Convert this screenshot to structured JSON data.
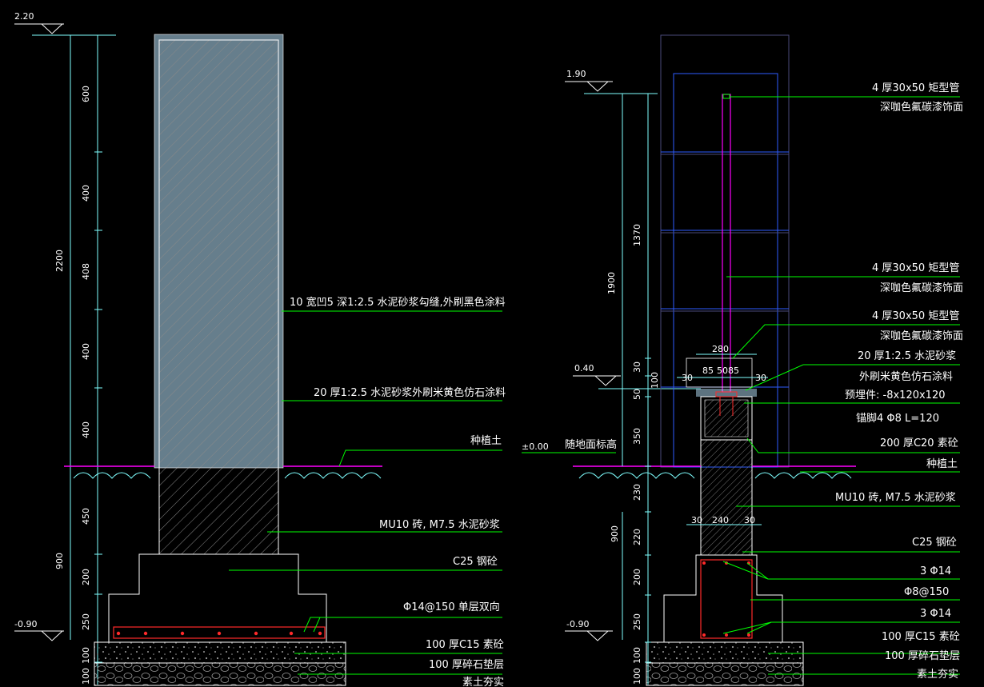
{
  "left": {
    "elev_top": "2.20",
    "elev_bottom": "-0.90",
    "dims_vertical": [
      "600",
      "400",
      "408",
      "400",
      "400",
      "2200",
      "450",
      "200",
      "250",
      "900",
      "100",
      "100"
    ],
    "labels": [
      "10  宽凹5 深1:2.5  水泥砂浆勾缝,外刷黑色涂料",
      "20  厚1:2.5  水泥砂浆外刷米黄色仿石涂料",
      "种植土",
      "MU10  砖, M7.5  水泥砂浆",
      "C25  钢砼",
      "Φ14@150  单层双向",
      "100  厚C15  素砼",
      "100  厚碎石垫层",
      "素土夯实"
    ]
  },
  "right": {
    "elev_top": "1.90",
    "elev_mid": "0.40",
    "elev_zero": "±0.00",
    "elev_bottom": "-0.90",
    "ground_label": "随地面标高",
    "dims_vertical": [
      "1370",
      "1900",
      "30",
      "100",
      "50",
      "350",
      "230",
      "220",
      "200",
      "250",
      "900",
      "100",
      "100"
    ],
    "dims_horizontal": [
      "280",
      "85",
      "50",
      "85",
      "30",
      "30",
      "30",
      "240",
      "30"
    ],
    "labels": [
      "4 厚30x50  矩型管",
      "深咖色氟碳漆饰面",
      "4 厚30x50  矩型管",
      "深咖色氟碳漆饰面",
      "4 厚30x50  矩型管",
      "深咖色氟碳漆饰面",
      "20  厚1:2.5  水泥砂浆",
      "外刷米黄色仿石涂料",
      "预埋件: -8x120x120",
      "锚脚4  Φ8  L=120",
      "200  厚C20  素砼",
      "种植土",
      "MU10  砖, M7.5  水泥砂浆",
      "C25  钢砼",
      "3  Φ14",
      "Φ8@150",
      "3  Φ14",
      "100  厚C15  素砼",
      "100  厚碎石垫层",
      "素土夯实"
    ]
  },
  "colors": {
    "background": "#000000",
    "outline": "#ffffff",
    "leader": "#00ff00",
    "dimension": "#7fffff",
    "plaster": "#b9e6ff",
    "rebar": "#ff2a2a",
    "ground": "#ff00ff",
    "frame": "#2e5cff",
    "pipe": "#ff00ff"
  }
}
